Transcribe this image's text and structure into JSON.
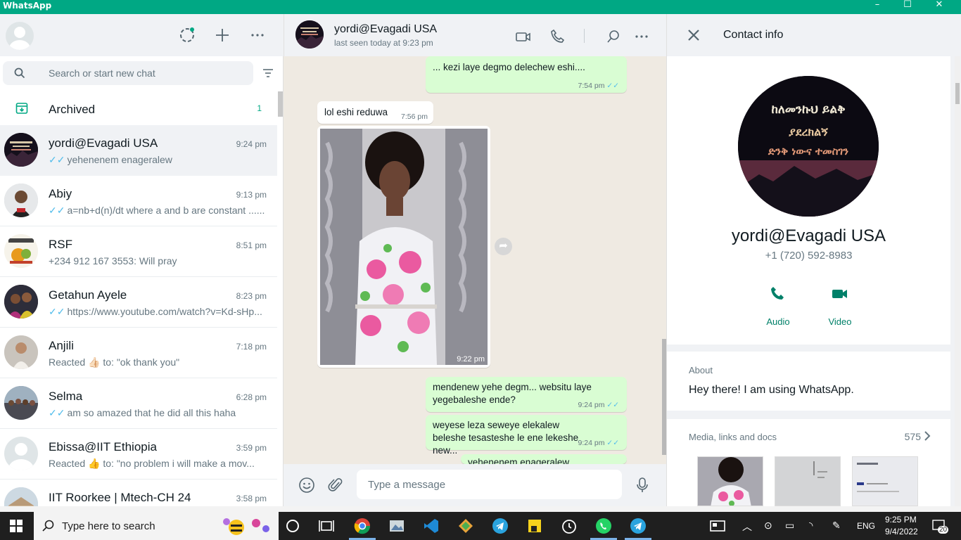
{
  "window": {
    "title": "WhatsApp",
    "minimize": "–",
    "maximize": "☐",
    "close": "✕"
  },
  "left": {
    "search_placeholder": "Search or start new chat",
    "archived": {
      "label": "Archived",
      "count": "1"
    },
    "chats": [
      {
        "name": "yordi@Evagadi USA",
        "time": "9:24 pm",
        "last": "yehenenem enageralew",
        "ticks": true,
        "active": true
      },
      {
        "name": "Abiy",
        "time": "9:13 pm",
        "last": "a=nb+d(n)/dt where a and b are constant ......",
        "ticks": true
      },
      {
        "name": "RSF",
        "time": "8:51 pm",
        "last": "+234 912 167 3553: Will pray",
        "ticks": false
      },
      {
        "name": "Getahun Ayele",
        "time": "8:23 pm",
        "last": "https://www.youtube.com/watch?v=Kd-sHp...",
        "ticks": true
      },
      {
        "name": "Anjili",
        "time": "7:18 pm",
        "last_prefix": "Reacted",
        "last_emoji": "👍🏻",
        "last_suffix": "to: \"ok thank you\"",
        "ticks": false
      },
      {
        "name": "Selma",
        "time": "6:28 pm",
        "last": "am so amazed that he did all this haha",
        "ticks": true
      },
      {
        "name": "Ebissa@IIT Ethiopia",
        "time": "3:59 pm",
        "last_prefix": "Reacted",
        "last_emoji": "👍",
        "last_suffix": "to: \"no problem i will make a mov...",
        "ticks": false
      },
      {
        "name": "IIT Roorkee | Mtech-CH 24",
        "time": "3:58 pm",
        "last": "",
        "ticks": false
      }
    ]
  },
  "conversation": {
    "contact_name": "yordi@Evagadi USA",
    "status": "last seen today at 9:23 pm",
    "messages": [
      {
        "text": "... kezi laye degmo delechew eshi....",
        "time": "7:54 pm",
        "dir": "out"
      },
      {
        "text": "lol eshi reduwa",
        "time": "7:56 pm",
        "dir": "in"
      },
      {
        "text": "",
        "time": "9:22 pm",
        "dir": "in",
        "type": "photo"
      },
      {
        "text": "mendenew yehe degm... websitu laye yegebaleshe ende?",
        "time": "9:24 pm",
        "dir": "out"
      },
      {
        "text": "weyese leza seweye elekalew beleshe tesasteshe le ene lekeshe new...",
        "time": "9:24 pm",
        "dir": "out"
      },
      {
        "text": "yehenenem enageralew",
        "time": "",
        "dir": "out"
      }
    ],
    "composer_placeholder": "Type a message"
  },
  "contact_info": {
    "title": "Contact info",
    "avatar_text": [
      "ከለመንኩህ ይልቅ",
      "ያደረክልኝ",
      "ድንቅ ነውና ተመስገን"
    ],
    "name": "yordi@Evagadi USA",
    "phone": "+1 (720) 592-8983",
    "actions": [
      {
        "label": "Audio",
        "icon": "phone-icon"
      },
      {
        "label": "Video",
        "icon": "video-icon"
      }
    ],
    "about_header": "About",
    "about_text": "Hey there! I am using WhatsApp.",
    "media_header": "Media, links and docs",
    "media_count": "575"
  },
  "taskbar": {
    "search_placeholder": "Type here to search",
    "language": "ENG",
    "time": "9:25 PM",
    "date": "9/4/2022",
    "notifications": "20"
  },
  "colors": {
    "accent": "#00a884",
    "outgoing": "#d9fdd3",
    "chat_bg": "#efeae2",
    "ticks": "#53bdeb"
  }
}
